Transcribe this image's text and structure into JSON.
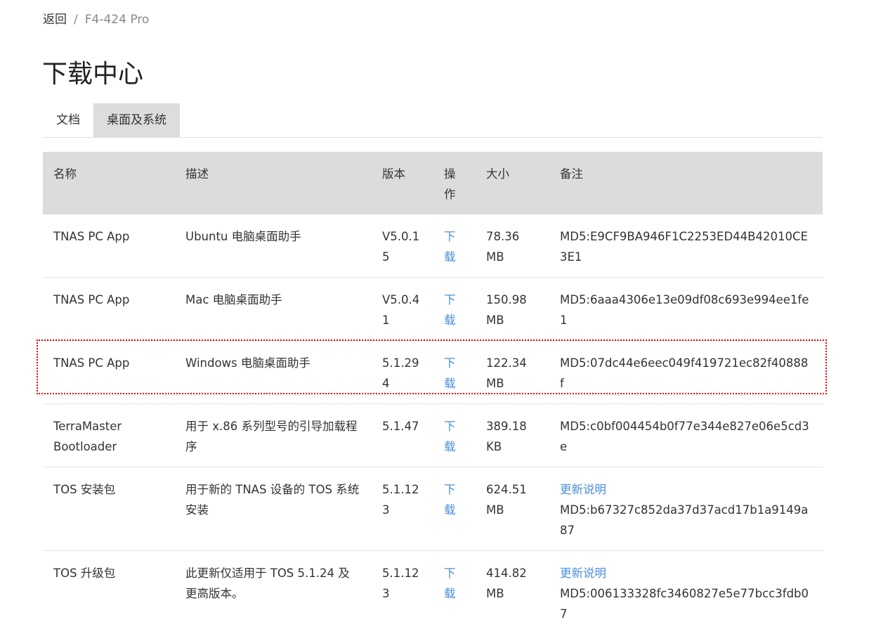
{
  "breadcrumb": {
    "back": "返回",
    "separator": "/",
    "current": "F4-424 Pro"
  },
  "page_title": "下载中心",
  "tabs": [
    {
      "label": "文档",
      "active": false
    },
    {
      "label": "桌面及系统",
      "active": true
    }
  ],
  "table": {
    "headers": [
      "名称",
      "描述",
      "版本",
      "操作",
      "大小",
      "备注"
    ],
    "rows": [
      {
        "name": "TNAS PC App",
        "desc": "Ubuntu 电脑桌面助手",
        "version": "V5.0.15",
        "action": "下载",
        "size": "78.36 MB",
        "note_link": "",
        "md5": "MD5:E9CF9BA946F1C2253ED44B42010CE3E1"
      },
      {
        "name": "TNAS PC App",
        "desc": "Mac 电脑桌面助手",
        "version": "V5.0.41",
        "action": "下载",
        "size": "150.98 MB",
        "note_link": "",
        "md5": "MD5:6aaa4306e13e09df08c693e994ee1fe1"
      },
      {
        "name": "TNAS PC App",
        "desc": "Windows 电脑桌面助手",
        "version": "5.1.294",
        "action": "下载",
        "size": "122.34 MB",
        "note_link": "",
        "md5": "MD5:07dc44e6eec049f419721ec82f40888f"
      },
      {
        "name": "TerraMaster Bootloader",
        "desc": "用于 x.86 系列型号的引导加载程序",
        "version": "5.1.47",
        "action": "下载",
        "size": "389.18 KB",
        "note_link": "",
        "md5": "MD5:c0bf004454b0f77e344e827e06e5cd3e"
      },
      {
        "name": "TOS 安装包",
        "desc": "用于新的 TNAS 设备的 TOS 系统安装",
        "version": "5.1.123",
        "action": "下载",
        "size": "624.51 MB",
        "note_link": "更新说明",
        "md5": "MD5:b67327c852da37d37acd17b1a9149a87"
      },
      {
        "name": "TOS 升级包",
        "desc": "此更新仅适用于 TOS 5.1.24 及更高版本。",
        "version": "5.1.123",
        "action": "下载",
        "size": "414.82 MB",
        "note_link": "更新说明",
        "md5": "MD5:006133328fc3460827e5e77bcc3fdb07"
      }
    ]
  },
  "colors": {
    "link": "#4a90d9",
    "header_bg": "#dcdcdc",
    "highlight": "#ee0000"
  }
}
